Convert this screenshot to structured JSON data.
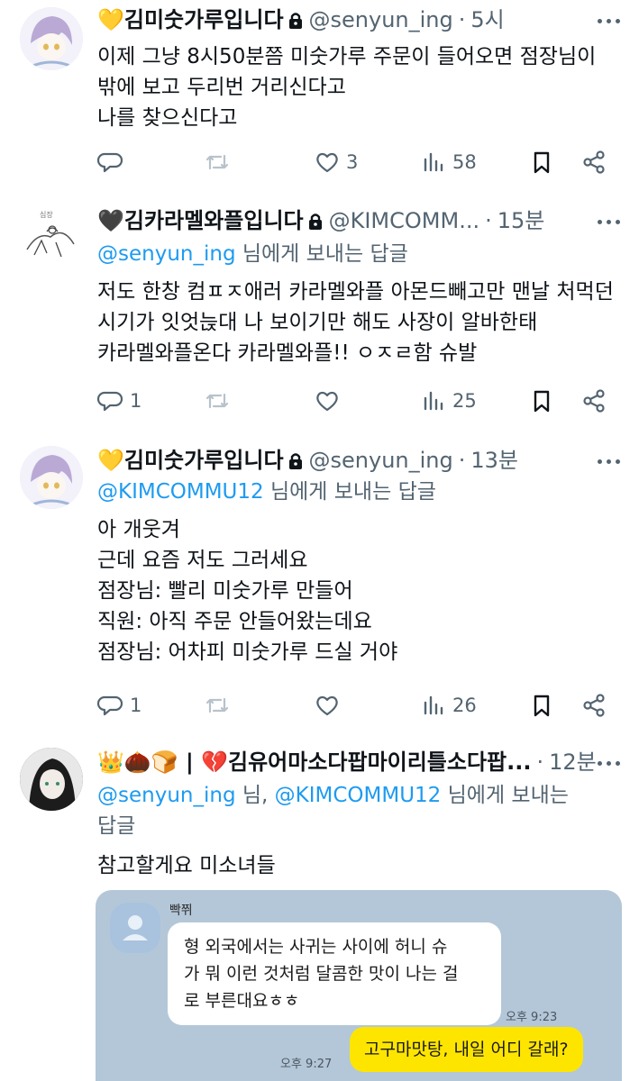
{
  "tweets": [
    {
      "name": "💛김미숫가루입니다",
      "handle": "@senyun_ing",
      "separator": "·",
      "time": "5시",
      "reply_prefix": "",
      "reply_mentions": [],
      "reply_suffix": "",
      "lines": [
        "이제 그냥 8시50분쯤 미숫가루 주문이 들어오면 점장님이",
        "밖에 보고 두리번 거리신다고",
        "나를 찾으신다고"
      ],
      "counts": {
        "replies": "",
        "retweets": "",
        "likes": "3",
        "views": "58"
      }
    },
    {
      "name": "🖤김카라멜와플입니다",
      "handle": "@KIMCOMM...",
      "separator": "·",
      "time": "15분",
      "reply_mentions": [
        "@senyun_ing"
      ],
      "reply_suffix": " 님에게 보내는 답글",
      "lines": [
        "저도 한창 컴ㅍㅈ애러 카라멜와플 아몬드빼고만 맨날 처먹던",
        "시기가 잇엇늕대 나 보이기만 해도 사장이 알바한태",
        "카라멜와플온다 카라멜와플!! ㅇㅈㄹ함 슈발"
      ],
      "counts": {
        "replies": "1",
        "retweets": "",
        "likes": "",
        "views": "25"
      }
    },
    {
      "name": "💛김미숫가루입니다",
      "handle": "@senyun_ing",
      "separator": "·",
      "time": "13분",
      "reply_mentions": [
        "@KIMCOMMU12"
      ],
      "reply_suffix": " 님에게 보내는 답글",
      "lines": [
        "아 개웃겨",
        "근데 요즘 저도 그러세요",
        "점장님: 빨리 미숫가루 만들어",
        "직원: 아직 주문 안들어왔는데요",
        "점장님: 어차피 미숫가루 드실 거야"
      ],
      "counts": {
        "replies": "1",
        "retweets": "",
        "likes": "",
        "views": "26"
      }
    },
    {
      "name": "👑🌰🍞 | 💔김유어마소다팝마이리틀소다팝...",
      "handle": "",
      "separator": "·",
      "time": "12분",
      "reply_mentions": [
        "@senyun_ing",
        "@KIMCOMMU12"
      ],
      "reply_mid": " 님, ",
      "reply_suffix": " 님에게 보내는",
      "reply_line2": "답글",
      "lines": [
        "참고할게요 미소녀들"
      ],
      "counts": {}
    }
  ],
  "chat": {
    "sender": "빡쮜",
    "incoming_lines": [
      "형 외국에서는 사귀는 사이에 허니 슈",
      "가 뭐 이런 것처럼 달콤한 맛이 나는 걸",
      "로 부른대요ㅎㅎ"
    ],
    "incoming_time": "오후 9:23",
    "outgoing": "고구마맛탕, 내일 어디 갈래?",
    "outgoing_time": "오후 9:27"
  },
  "colors": {
    "text": "#0f1419",
    "secondary": "#536471",
    "link": "#1d9bf0",
    "kakao_bg": "#b4c7d8",
    "kakao_yellow": "#fee500"
  },
  "icons": [
    "reply-icon",
    "retweet-icon",
    "heart-icon",
    "views-icon",
    "bookmark-icon",
    "share-icon",
    "lock-icon",
    "more-icon"
  ]
}
